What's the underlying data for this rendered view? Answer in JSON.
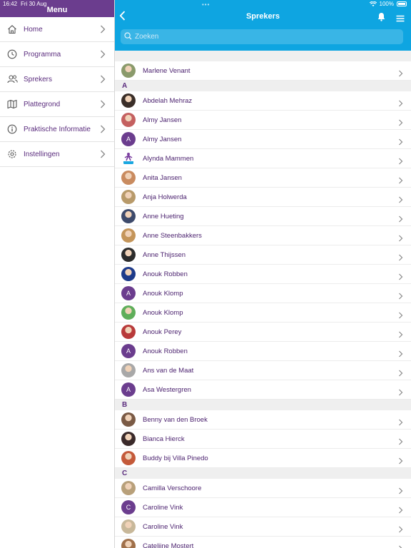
{
  "status_bar": {
    "time": "16:42",
    "date": "Fri 30 Aug",
    "battery": "100%"
  },
  "colors": {
    "header_blue": "#0ea5e1",
    "sidebar_purple": "#6b3d8e",
    "text_purple": "#5b2d7e"
  },
  "sidebar": {
    "title": "Menu",
    "items": [
      {
        "label": "Home",
        "icon": "home-icon"
      },
      {
        "label": "Programma",
        "icon": "clock-icon"
      },
      {
        "label": "Sprekers",
        "icon": "people-icon"
      },
      {
        "label": "Plattegrond",
        "icon": "map-icon"
      },
      {
        "label": "Praktische Informatie",
        "icon": "info-icon"
      },
      {
        "label": "Instellingen",
        "icon": "settings-icon"
      }
    ]
  },
  "header": {
    "title": "Sprekers",
    "back_icon": "chevron-left-icon",
    "bell_icon": "bell-icon",
    "menu_icon": "hamburger-icon"
  },
  "search": {
    "placeholder": "Zoeken",
    "value": ""
  },
  "list": {
    "top": [
      {
        "name": "Marlene Venant",
        "avatar": "photo",
        "color": "#8a9a6b"
      }
    ],
    "sections": [
      {
        "letter": "A",
        "rows": [
          {
            "name": "Abdelah Mehraz",
            "avatar": "photo",
            "color": "#3a2e28"
          },
          {
            "name": "Almy Jansen",
            "avatar": "photo",
            "color": "#c46060"
          },
          {
            "name": "Almy Jansen",
            "avatar": "A",
            "color": "#6b3d8e"
          },
          {
            "name": "Alynda Mammen",
            "avatar": "logo",
            "color": "#ffffff"
          },
          {
            "name": "Anita Jansen",
            "avatar": "photo",
            "color": "#c98b5f"
          },
          {
            "name": "Anja Holwerda",
            "avatar": "photo",
            "color": "#b89a6a"
          },
          {
            "name": "Anne Hueting",
            "avatar": "photo",
            "color": "#3d4a6b"
          },
          {
            "name": "Anne Steenbakkers",
            "avatar": "photo",
            "color": "#c4955a"
          },
          {
            "name": "Anne Thijssen",
            "avatar": "photo",
            "color": "#2c2c2c"
          },
          {
            "name": "Anouk Robben",
            "avatar": "photo",
            "color": "#1d3a8a"
          },
          {
            "name": "Anouk Klomp",
            "avatar": "A",
            "color": "#6b3d8e"
          },
          {
            "name": "Anouk Klomp",
            "avatar": "photo",
            "color": "#5fae5a"
          },
          {
            "name": "Anouk Perey",
            "avatar": "photo",
            "color": "#b83a3a"
          },
          {
            "name": "Anouk Robben",
            "avatar": "A",
            "color": "#6b3d8e"
          },
          {
            "name": "Ans van de Maat",
            "avatar": "photo",
            "color": "#a8a8a8"
          },
          {
            "name": "Asa Westergren",
            "avatar": "A",
            "color": "#6b3d8e"
          }
        ]
      },
      {
        "letter": "B",
        "rows": [
          {
            "name": "Benny van den Broek",
            "avatar": "photo",
            "color": "#7a5a45"
          },
          {
            "name": "Bianca Hierck",
            "avatar": "photo",
            "color": "#3a2a2a"
          },
          {
            "name": "Buddy bij Villa Pinedo",
            "avatar": "photo",
            "color": "#c45a3a"
          }
        ]
      },
      {
        "letter": "C",
        "rows": [
          {
            "name": "Camilla Verschoore",
            "avatar": "photo",
            "color": "#b8a07a"
          },
          {
            "name": "Caroline Vink",
            "avatar": "C",
            "color": "#6b3d8e"
          },
          {
            "name": "Caroline Vink",
            "avatar": "photo",
            "color": "#c8b89a"
          },
          {
            "name": "Catelijne Mostert",
            "avatar": "photo",
            "color": "#a0704a"
          }
        ]
      }
    ]
  }
}
